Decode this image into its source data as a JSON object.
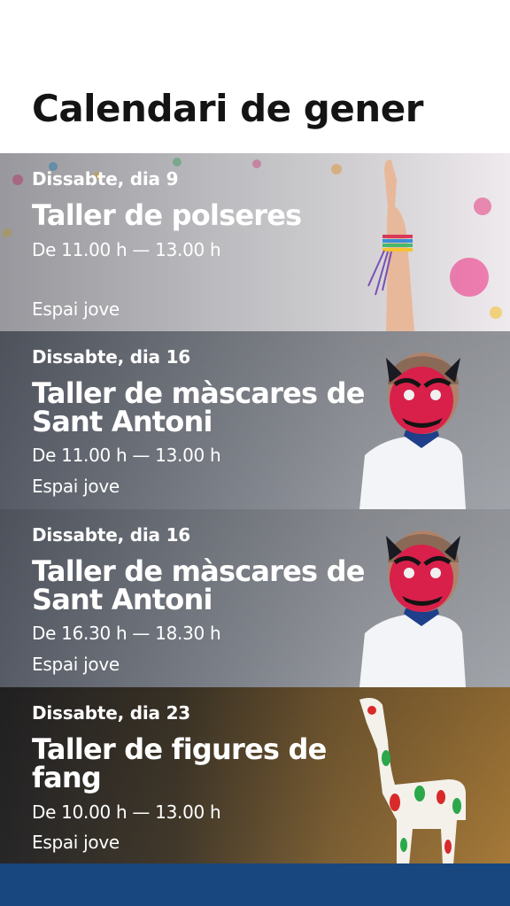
{
  "page": {
    "title": "Calendari de gener"
  },
  "events": [
    {
      "date": "Dissabte, dia 9",
      "title": "Taller de polseres",
      "time": "De 11.00 h — 13.00 h",
      "place": "Espai jove",
      "image": "bracelet-hand-photo"
    },
    {
      "date": "Dissabte, dia 16",
      "title": "Taller de màscares de Sant Antoni",
      "time": "De 11.00 h — 13.00 h",
      "place": "Espai jove",
      "image": "devil-mask-child-photo"
    },
    {
      "date": "Dissabte, dia 16",
      "title": "Taller de màscares de Sant Antoni",
      "time": "De 16.30 h — 18.30 h",
      "place": "Espai jove",
      "image": "devil-mask-child-photo"
    },
    {
      "date": "Dissabte, dia 23",
      "title": "Taller de figures de fang",
      "time": "De 10.00 h — 13.00 h",
      "place": "Espai jove",
      "image": "clay-figure-photo"
    }
  ],
  "colors": {
    "footer": "#17477e",
    "text": "#ffffff",
    "title": "#141414"
  }
}
